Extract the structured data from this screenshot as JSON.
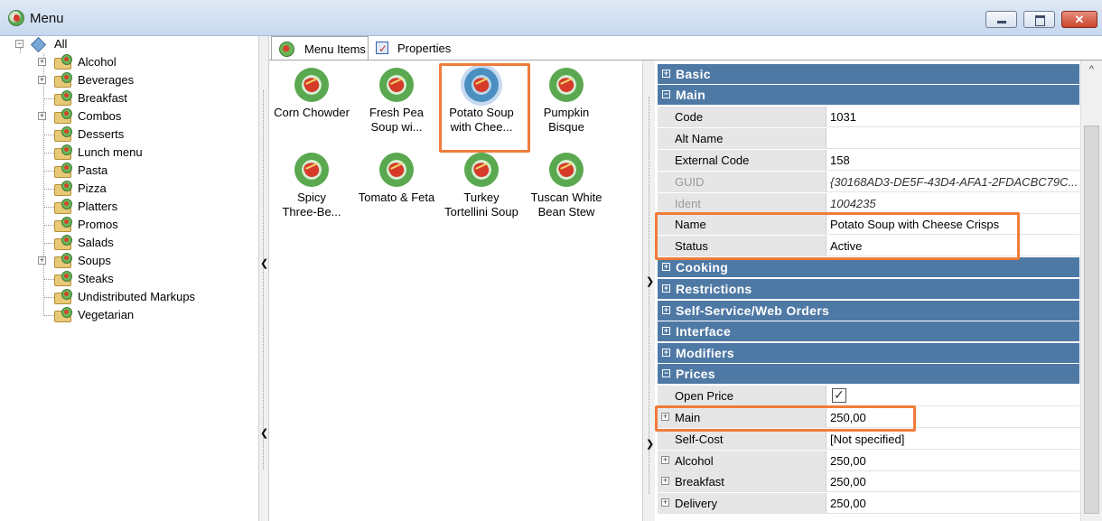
{
  "window": {
    "title": "Menu"
  },
  "tree": {
    "root": "All",
    "items": [
      {
        "label": "Alcohol",
        "expandable": true
      },
      {
        "label": "Beverages",
        "expandable": true
      },
      {
        "label": "Breakfast",
        "expandable": false
      },
      {
        "label": "Combos",
        "expandable": true
      },
      {
        "label": "Desserts",
        "expandable": false
      },
      {
        "label": "Lunch menu",
        "expandable": false
      },
      {
        "label": "Pasta",
        "expandable": false
      },
      {
        "label": "Pizza",
        "expandable": false
      },
      {
        "label": "Platters",
        "expandable": false
      },
      {
        "label": "Promos",
        "expandable": false
      },
      {
        "label": "Salads",
        "expandable": false
      },
      {
        "label": "Soups",
        "expandable": true
      },
      {
        "label": "Steaks",
        "expandable": false
      },
      {
        "label": "Undistributed Markups",
        "expandable": false
      },
      {
        "label": "Vegetarian",
        "expandable": false
      }
    ]
  },
  "tabs": [
    {
      "label": "Menu Items",
      "active": true
    },
    {
      "label": "Properties",
      "active": false
    }
  ],
  "menu_items": [
    {
      "line1": "Corn Chowder",
      "line2": ""
    },
    {
      "line1": "Fresh Pea",
      "line2": "Soup wi..."
    },
    {
      "line1": "Potato Soup",
      "line2": "with Chee...",
      "selected": true
    },
    {
      "line1": "Pumpkin",
      "line2": "Bisque"
    },
    {
      "line1": "Spicy",
      "line2": "Three-Be..."
    },
    {
      "line1": "Tomato & Feta",
      "line2": ""
    },
    {
      "line1": "Turkey",
      "line2": "Tortellini Soup"
    },
    {
      "line1": "Tuscan White",
      "line2": "Bean Stew"
    }
  ],
  "properties": {
    "categories": {
      "basic": "Basic",
      "main": "Main",
      "cooking": "Cooking",
      "restrictions": "Restrictions",
      "self_service": "Self-Service/Web Orders",
      "interface": "Interface",
      "modifiers": "Modifiers",
      "prices": "Prices"
    },
    "main_rows": [
      {
        "name": "Code",
        "value": "1031"
      },
      {
        "name": "Alt Name",
        "value": ""
      },
      {
        "name": "External Code",
        "value": "158"
      },
      {
        "name": "GUID",
        "value": "{30168AD3-DE5F-43D4-AFA1-2FDACBC79C..."
      },
      {
        "name": "Ident",
        "value": "1004235"
      },
      {
        "name": "Name",
        "value": "Potato Soup with Cheese Crisps"
      },
      {
        "name": "Status",
        "value": "Active"
      }
    ],
    "price_rows": [
      {
        "name": "Open Price",
        "value": ""
      },
      {
        "name": "Main",
        "value": "250,00"
      },
      {
        "name": "Self-Cost",
        "value": "[Not specified]"
      },
      {
        "name": "Alcohol",
        "value": "250,00"
      },
      {
        "name": "Breakfast",
        "value": "250,00"
      },
      {
        "name": "Delivery",
        "value": "250,00"
      }
    ],
    "open_price_checked": true
  },
  "colors": {
    "category_header": "#4f79a5",
    "highlight": "#f07c3a"
  }
}
